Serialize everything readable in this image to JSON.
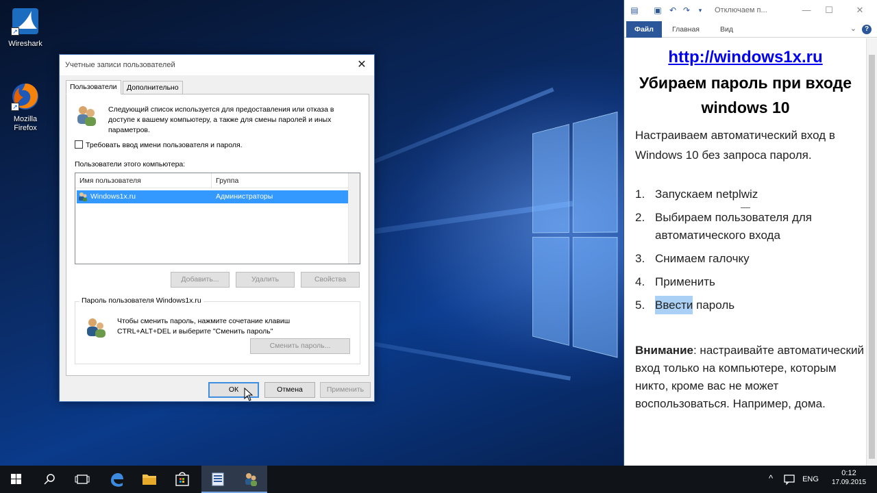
{
  "desktop": {
    "icons": [
      {
        "label": "Wireshark"
      },
      {
        "label": "Mozilla Firefox"
      }
    ]
  },
  "dialog": {
    "title": "Учетные записи пользователей",
    "tabs": [
      {
        "label": "Пользователи",
        "active": true
      },
      {
        "label": "Дополнительно",
        "active": false
      }
    ],
    "description": "Следующий список используется для предоставления или отказа в доступе к вашему компьютеру, а также для смены паролей и иных параметров.",
    "require_login_checkbox": {
      "label": "Требовать ввод имени пользователя и пароля.",
      "checked": false
    },
    "users_label": "Пользователи этого компьютера:",
    "table": {
      "columns": [
        "Имя пользователя",
        "Группа"
      ],
      "rows": [
        {
          "name": "Windows1x.ru",
          "group": "Администраторы",
          "selected": true
        }
      ]
    },
    "buttons": {
      "add": "Добавить...",
      "remove": "Удалить",
      "properties": "Свойства"
    },
    "password_group": {
      "legend": "Пароль пользователя Windows1x.ru",
      "text": "Чтобы сменить пароль, нажмите сочетание клавиш CTRL+ALT+DEL и выберите \"Сменить пароль\"",
      "button": "Сменить пароль..."
    },
    "footer": {
      "ok": "ОК",
      "cancel": "Отмена",
      "apply": "Применить"
    }
  },
  "word": {
    "doc_title": "Отключаем п...",
    "ribbon_tabs": [
      "Файл",
      "Главная",
      "Вид"
    ],
    "link": "http://windows1x.ru",
    "heading": "Убираем пароль при входе windows 10",
    "intro": "Настраиваем автоматический вход в Windows 10 без запроса пароля.",
    "separator": "—",
    "steps": [
      {
        "num": "1.",
        "text": "Запускаем netplwiz"
      },
      {
        "num": "2.",
        "text": "Выбираем пользователя для автоматического входа"
      },
      {
        "num": "3.",
        "text": "Снимаем галочку"
      },
      {
        "num": "4.",
        "text": "Применить"
      },
      {
        "num": "5.",
        "text_highlight": "Ввести",
        "text_rest": " пароль"
      }
    ],
    "warning_bold": "Внимание",
    "warning_text": ": настраивайте автоматический вход только на компьютере, которым никто, кроме вас не может воспользоваться. Например, дома."
  },
  "taskbar": {
    "language": "ENG",
    "time": "0:12",
    "date": "17.09.2015"
  },
  "colors": {
    "accent": "#2b579a",
    "selection": "#3399ff",
    "highlight": "#aad0f5"
  }
}
